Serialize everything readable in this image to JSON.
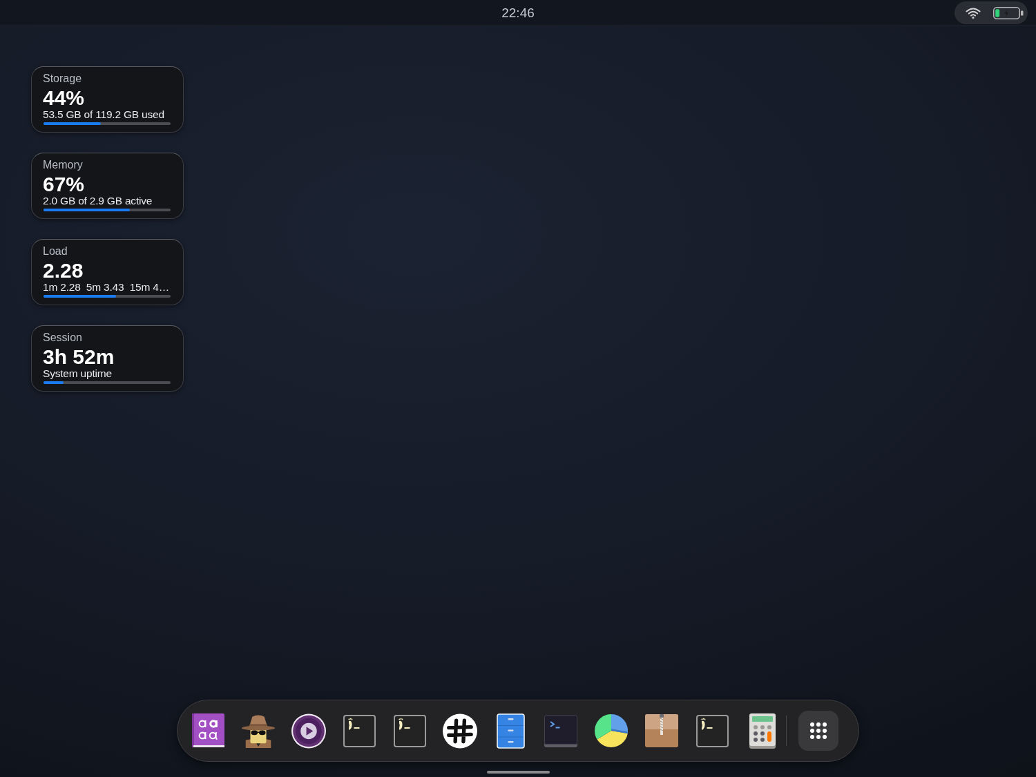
{
  "top_bar": {
    "clock": "22:46"
  },
  "widgets": [
    {
      "label": "Storage",
      "value": "44%",
      "detail": "53.5 GB of 119.2 GB used",
      "level": 0.45
    },
    {
      "label": "Memory",
      "value": "67%",
      "detail": "2.0 GB of 2.9 GB active",
      "level": 0.68
    },
    {
      "label": "Load",
      "value": "2.28",
      "detail": "1m 2.28  5m 3.43  15m 4…",
      "level": 0.57
    },
    {
      "label": "Session",
      "value": "3h 52m",
      "detail": "System uptime",
      "level": 0.16
    }
  ],
  "dock": {
    "apps": [
      {
        "kind": "fonts"
      },
      {
        "kind": "spy"
      },
      {
        "kind": "player"
      },
      {
        "kind": "foot"
      },
      {
        "kind": "foot"
      },
      {
        "kind": "hash"
      },
      {
        "kind": "cabinet"
      },
      {
        "kind": "terminal"
      },
      {
        "kind": "pie"
      },
      {
        "kind": "archive"
      },
      {
        "kind": "foot"
      },
      {
        "kind": "calculator"
      }
    ]
  }
}
